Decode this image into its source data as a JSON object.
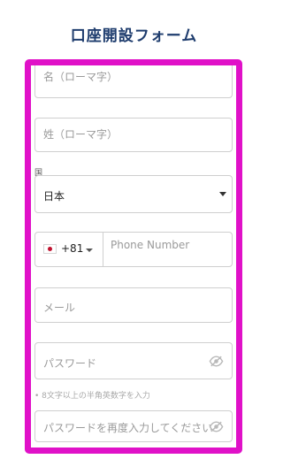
{
  "form_title": "口座開設フォーム",
  "fields": {
    "name_placeholder": "名（ローマ字）",
    "surname_placeholder": "姓（ローマ字）",
    "country_label": "国",
    "country_value": "日本",
    "phone_code": "+81",
    "phone_placeholder": "Phone Number",
    "email_placeholder": "メール",
    "password_placeholder": "パスワード",
    "password_hint": "8文字以上の半角英数字を入力",
    "confirm_password_placeholder": "パスワードを再度入力してください"
  },
  "icons": {
    "country_flag": "japan-flag-icon",
    "password_toggle": "eye-off-icon"
  },
  "colors": {
    "highlight_border": "#e011c8",
    "title_text": "#1f3d6e",
    "flag_red": "#c0122f"
  }
}
